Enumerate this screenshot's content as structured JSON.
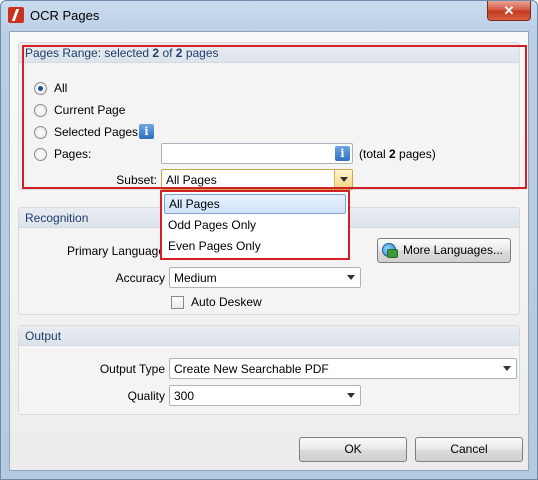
{
  "window": {
    "title": "OCR Pages",
    "close_label": "✕"
  },
  "pages_range": {
    "header_prefix": "Pages Range: selected ",
    "selected": "2",
    "header_mid": " of ",
    "total": "2",
    "header_suffix": " pages",
    "options": {
      "all": "All",
      "current_page": "Current Page",
      "selected_pages": "Selected Pages",
      "pages": "Pages:"
    },
    "pages_value": "",
    "total_note_prefix": "(total ",
    "total_note_count": "2",
    "total_note_suffix": " pages)",
    "subset_label": "Subset:",
    "subset_value": "All Pages",
    "subset_options": [
      "All Pages",
      "Odd Pages Only",
      "Even Pages Only"
    ]
  },
  "recognition": {
    "header": "Recognition",
    "primary_language_label": "Primary Language",
    "more_languages_label": "More Languages...",
    "accuracy_label": "Accuracy",
    "accuracy_value": "Medium",
    "auto_deskew_label": "Auto Deskew"
  },
  "output": {
    "header": "Output",
    "output_type_label": "Output Type",
    "output_type_value": "Create New Searchable PDF",
    "quality_label": "Quality",
    "quality_value": "300"
  },
  "buttons": {
    "ok": "OK",
    "cancel": "Cancel"
  },
  "colors": {
    "highlight": "#d41f26",
    "header_text": "#1e3d6b",
    "radio_dot": "#1c4f9a"
  }
}
